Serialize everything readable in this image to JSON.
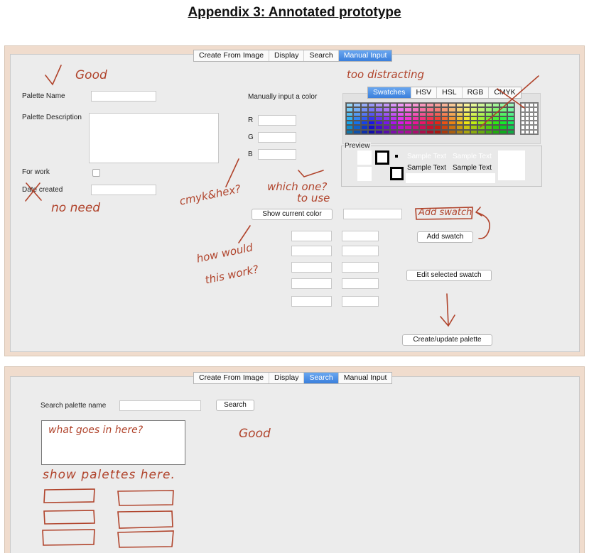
{
  "heading": "Appendix 3: Annotated prototype",
  "top": {
    "tabs": [
      {
        "label": "Create From Image",
        "selected": false
      },
      {
        "label": "Display",
        "selected": false
      },
      {
        "label": "Search",
        "selected": false
      },
      {
        "label": "Manual Input",
        "selected": true
      }
    ],
    "palette_name_label": "Palette Name",
    "palette_description_label": "Palette Description",
    "for_work_label": "For work",
    "date_created_label": "Date created",
    "manual_label": "Manually input a color",
    "r_label": "R",
    "g_label": "G",
    "b_label": "B",
    "color_tabs": [
      {
        "label": "Swatches",
        "selected": true
      },
      {
        "label": "HSV",
        "selected": false
      },
      {
        "label": "HSL",
        "selected": false
      },
      {
        "label": "RGB",
        "selected": false
      },
      {
        "label": "CMYK",
        "selected": false
      }
    ],
    "preview_label": "Preview",
    "sample_text": "Sample Text",
    "show_current_color": "Show current color",
    "add_swatch": "Add swatch",
    "edit_selected_swatch": "Edit selected swatch",
    "create_update_palette": "Create/update palette"
  },
  "bottom": {
    "tabs": [
      {
        "label": "Create From Image",
        "selected": false
      },
      {
        "label": "Display",
        "selected": false
      },
      {
        "label": "Search",
        "selected": true
      },
      {
        "label": "Manual Input",
        "selected": false
      }
    ],
    "search_palette_name_label": "Search palette name",
    "search_button": "Search"
  },
  "annotations": {
    "good_top": "Good",
    "too_distracting": "too distracting",
    "no_need": "no need",
    "cmyk_hex": "cmyk&hex?",
    "which_one": "which one?",
    "to_use": "to use",
    "add_swatch_note": "Add swatch",
    "how_would": "how would",
    "this_work": "this work?",
    "what_goes": "what goes in here?",
    "good_bottom": "Good",
    "show_palettes": "show palettes here."
  },
  "colors": {
    "annotation": "#b0432b",
    "tab_selected": "#3a7fdc",
    "frame": "#f0dccd",
    "panel": "#ececec"
  }
}
